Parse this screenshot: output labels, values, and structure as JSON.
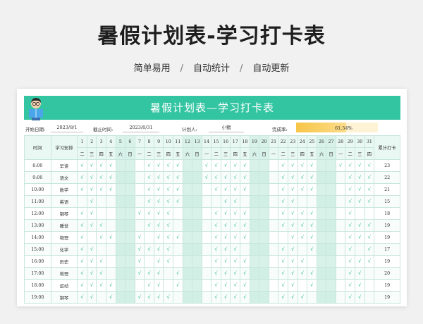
{
  "page": {
    "title": "暑假计划表-学习打卡表",
    "features": [
      "简单易用",
      "自动统计",
      "自动更新"
    ],
    "separator": "/"
  },
  "sheet": {
    "title": "暑假计划表—学习打卡表",
    "start_label": "开始日期:",
    "start_value": "2023/8/1",
    "end_label": "截止时间:",
    "end_value": "2023/8/31",
    "planner_label": "计划人:",
    "planner_value": "小猪",
    "completion_label": "完成率:",
    "completion_text": "61.54%",
    "completion_fraction": 0.6154,
    "header_time": "时间",
    "header_subject": "学习安排",
    "header_total": "累计打卡",
    "days": [
      "1",
      "2",
      "3",
      "4",
      "5",
      "6",
      "7",
      "8",
      "9",
      "10",
      "11",
      "12",
      "13",
      "14",
      "15",
      "16",
      "17",
      "18",
      "19",
      "20",
      "21",
      "22",
      "23",
      "24",
      "25",
      "26",
      "27",
      "28",
      "29",
      "30",
      "31"
    ],
    "weekdays": [
      "二",
      "三",
      "四",
      "五",
      "六",
      "日",
      "一",
      "二",
      "三",
      "四",
      "五",
      "六",
      "日",
      "一",
      "二",
      "三",
      "四",
      "五",
      "六",
      "日",
      "一",
      "二",
      "三",
      "四",
      "五",
      "六",
      "日",
      "一",
      "二",
      "三",
      "四"
    ],
    "weekend_indices": [
      4,
      5,
      11,
      12,
      18,
      19,
      25,
      26
    ],
    "check_mark": "√",
    "rows": [
      {
        "time": "8:00",
        "subject": "早读",
        "total": "23",
        "checks": [
          1,
          1,
          1,
          1,
          0,
          0,
          0,
          1,
          1,
          1,
          1,
          0,
          0,
          1,
          1,
          1,
          1,
          1,
          0,
          0,
          0,
          1,
          1,
          1,
          1,
          0,
          0,
          1,
          1,
          1,
          1
        ]
      },
      {
        "time": "9:00",
        "subject": "语文",
        "total": "22",
        "checks": [
          1,
          1,
          1,
          1,
          0,
          0,
          0,
          1,
          1,
          1,
          1,
          0,
          0,
          1,
          1,
          1,
          1,
          1,
          0,
          0,
          0,
          1,
          1,
          1,
          1,
          0,
          0,
          0,
          1,
          1,
          1
        ]
      },
      {
        "time": "10:00",
        "subject": "数学",
        "total": "21",
        "checks": [
          1,
          1,
          1,
          1,
          0,
          0,
          0,
          1,
          1,
          1,
          1,
          0,
          0,
          0,
          1,
          1,
          1,
          1,
          0,
          0,
          0,
          1,
          1,
          1,
          1,
          0,
          0,
          0,
          1,
          1,
          1
        ]
      },
      {
        "time": "11:00",
        "subject": "英语",
        "total": "15",
        "checks": [
          0,
          1,
          0,
          0,
          0,
          0,
          0,
          1,
          1,
          1,
          1,
          0,
          0,
          0,
          0,
          1,
          1,
          0,
          0,
          0,
          0,
          1,
          1,
          0,
          0,
          0,
          0,
          0,
          1,
          1,
          1
        ]
      },
      {
        "time": "12:00",
        "subject": "钢琴",
        "total": "18",
        "checks": [
          1,
          1,
          0,
          0,
          0,
          0,
          1,
          1,
          1,
          1,
          0,
          0,
          0,
          0,
          1,
          1,
          1,
          1,
          0,
          0,
          0,
          1,
          1,
          1,
          1,
          0,
          0,
          0,
          1,
          0,
          0
        ]
      },
      {
        "time": "13:00",
        "subject": "睡觉",
        "total": "19",
        "checks": [
          1,
          1,
          1,
          0,
          0,
          0,
          0,
          1,
          1,
          1,
          0,
          0,
          0,
          0,
          1,
          1,
          1,
          1,
          0,
          0,
          0,
          1,
          1,
          1,
          1,
          0,
          0,
          0,
          1,
          1,
          1
        ]
      },
      {
        "time": "14:00",
        "subject": "物理",
        "total": "19",
        "checks": [
          1,
          0,
          1,
          1,
          0,
          0,
          1,
          0,
          1,
          1,
          1,
          0,
          0,
          0,
          1,
          1,
          1,
          1,
          0,
          0,
          0,
          0,
          1,
          1,
          1,
          0,
          0,
          0,
          1,
          1,
          1
        ]
      },
      {
        "time": "15:00",
        "subject": "化学",
        "total": "17",
        "checks": [
          1,
          1,
          0,
          0,
          0,
          0,
          1,
          1,
          1,
          1,
          0,
          0,
          0,
          0,
          1,
          1,
          1,
          0,
          0,
          0,
          0,
          1,
          1,
          0,
          1,
          0,
          0,
          0,
          1,
          0,
          1
        ]
      },
      {
        "time": "16:00",
        "subject": "历史",
        "total": "19",
        "checks": [
          1,
          1,
          1,
          0,
          0,
          0,
          1,
          0,
          1,
          1,
          0,
          0,
          0,
          0,
          1,
          1,
          1,
          1,
          0,
          0,
          0,
          1,
          1,
          1,
          0,
          0,
          0,
          0,
          1,
          1,
          1
        ]
      },
      {
        "time": "17:00",
        "subject": "地理",
        "total": "20",
        "checks": [
          1,
          1,
          1,
          0,
          0,
          0,
          1,
          1,
          1,
          0,
          1,
          0,
          0,
          0,
          1,
          1,
          1,
          1,
          0,
          0,
          0,
          1,
          1,
          1,
          1,
          0,
          0,
          0,
          1,
          1,
          0
        ]
      },
      {
        "time": "18:00",
        "subject": "运动",
        "total": "19",
        "checks": [
          1,
          1,
          1,
          1,
          0,
          0,
          0,
          1,
          1,
          0,
          1,
          0,
          0,
          0,
          1,
          1,
          1,
          1,
          0,
          0,
          0,
          1,
          1,
          0,
          1,
          0,
          0,
          0,
          1,
          1,
          0
        ]
      },
      {
        "time": "19:00",
        "subject": "钢琴",
        "total": "19",
        "checks": [
          1,
          1,
          0,
          1,
          0,
          0,
          1,
          1,
          1,
          1,
          0,
          0,
          0,
          0,
          1,
          1,
          1,
          1,
          0,
          0,
          0,
          1,
          1,
          1,
          0,
          0,
          0,
          0,
          1,
          1,
          0
        ]
      }
    ]
  },
  "colors": {
    "accent": "#33c5a2",
    "check": "#28b592",
    "progress": "#f7c548"
  }
}
